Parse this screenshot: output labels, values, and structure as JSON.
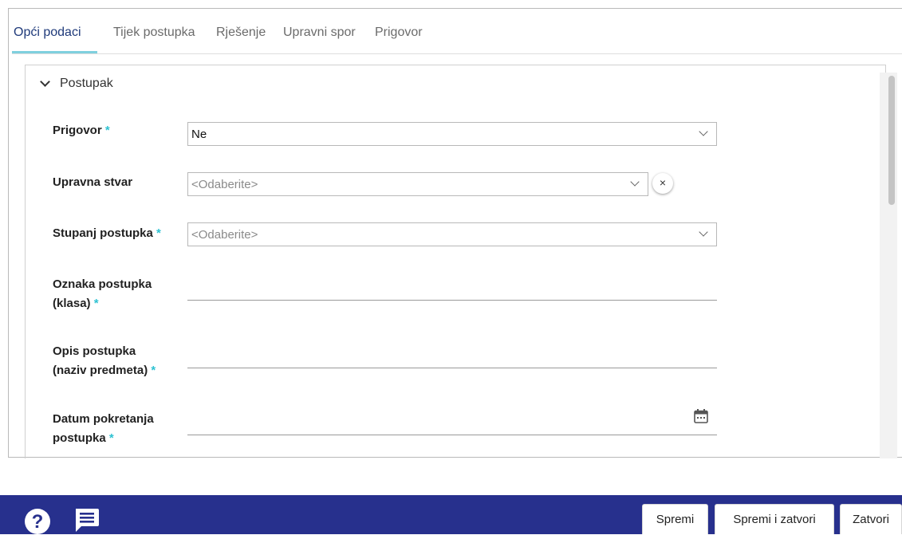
{
  "tabs": [
    {
      "label": "Opći podaci",
      "active": true
    },
    {
      "label": "Tijek postupka",
      "active": false
    },
    {
      "label": "Rješenje",
      "active": false
    },
    {
      "label": "Upravni spor",
      "active": false
    },
    {
      "label": "Prigovor",
      "active": false
    }
  ],
  "section": {
    "title": "Postupak",
    "icon": "chevron-down-icon"
  },
  "form": {
    "prigovor": {
      "label": "Prigovor",
      "required": "*",
      "value": "Ne"
    },
    "upravna_stvar": {
      "label": "Upravna stvar",
      "placeholder": "<Odaberite>",
      "clear": "×"
    },
    "stupanj": {
      "label": "Stupanj postupka",
      "required": "*",
      "placeholder": "<Odaberite>"
    },
    "oznaka": {
      "label_line1": "Oznaka postupka",
      "label_line2": "(klasa)",
      "required": "*",
      "value": ""
    },
    "opis": {
      "label_line1": "Opis postupka",
      "label_line2": "(naziv predmeta)",
      "required": "*",
      "value": ""
    },
    "datum": {
      "label_line1": "Datum pokretanja",
      "label_line2": "postupka",
      "required": "*",
      "value": "",
      "icon": "calendar-icon"
    }
  },
  "footer": {
    "help_icon": "help-icon",
    "help_glyph": "?",
    "chat_icon": "chat-icon",
    "buttons": {
      "save": "Spremi",
      "save_close": "Spremi i zatvori",
      "close": "Zatvori"
    }
  },
  "colors": {
    "accent": "#7fd0de",
    "required": "#2fc2d2",
    "active_tab": "#1f3a7a",
    "bottom_bar": "#27308d"
  }
}
